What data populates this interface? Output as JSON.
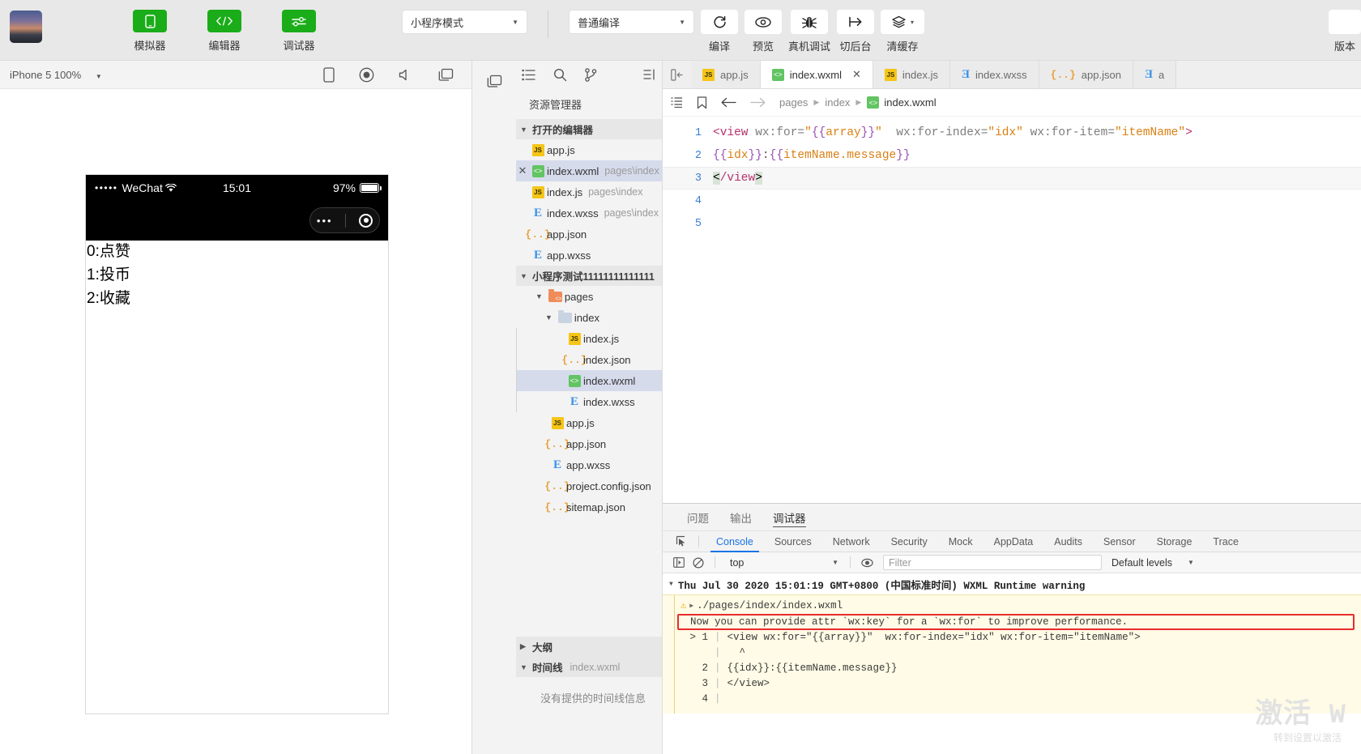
{
  "toolbar": {
    "avatar_name": "project-avatar",
    "buttons": [
      {
        "label": "模拟器",
        "icon": "phone-icon"
      },
      {
        "label": "编辑器",
        "icon": "code-icon"
      },
      {
        "label": "调试器",
        "icon": "sliders-icon"
      }
    ],
    "mode_select": "小程序模式",
    "compile_select": "普通编译",
    "actions": [
      {
        "label": "编译",
        "icon": "refresh-icon"
      },
      {
        "label": "预览",
        "icon": "eye-icon"
      },
      {
        "label": "真机调试",
        "icon": "bug-icon"
      },
      {
        "label": "切后台",
        "icon": "background-icon"
      },
      {
        "label": "清缓存",
        "icon": "layers-icon"
      }
    ],
    "version_label": "版本"
  },
  "simulator": {
    "device": "iPhone 5 100%",
    "toolbar_icons": [
      "rotate-device-icon",
      "record-icon",
      "volume-icon",
      "window-icon"
    ],
    "status_bar": {
      "signal_dots": "•••••",
      "carrier": "WeChat",
      "wifi": "wifi-icon",
      "time": "15:01",
      "battery_percent": "97%"
    },
    "capsule": {
      "more": "•••",
      "target": "target-icon"
    },
    "page_lines": [
      "0:点赞",
      "1:投币",
      "2:收藏"
    ]
  },
  "explorer": {
    "rail_icons": [
      "window-icon"
    ],
    "tool_icons": [
      "files-icon",
      "search-icon",
      "source-control-icon",
      "collapse-all-icon"
    ],
    "title": "资源管理器",
    "open_editors": {
      "label": "打开的编辑器",
      "items": [
        {
          "name": "app.js",
          "path": "",
          "icon": "js-icon",
          "selected": false,
          "closable": false
        },
        {
          "name": "index.wxml",
          "path": "pages\\index",
          "icon": "wxml-icon",
          "selected": true,
          "closable": true
        },
        {
          "name": "index.js",
          "path": "pages\\index",
          "icon": "js-icon",
          "selected": false,
          "closable": false
        },
        {
          "name": "index.wxss",
          "path": "pages\\index",
          "icon": "wxss-icon",
          "selected": false,
          "closable": false
        },
        {
          "name": "app.json",
          "path": "",
          "icon": "json-icon",
          "selected": false,
          "closable": false
        },
        {
          "name": "app.wxss",
          "path": "",
          "icon": "wxss-icon",
          "selected": false,
          "closable": false
        }
      ]
    },
    "project": {
      "label": "小程序测试11111111111111",
      "tree": [
        {
          "name": "pages",
          "icon": "folder-mini-icon",
          "depth": 1,
          "expanded": true,
          "selected": false
        },
        {
          "name": "index",
          "icon": "folder-icon",
          "depth": 2,
          "expanded": true,
          "selected": false
        },
        {
          "name": "index.js",
          "icon": "js-icon",
          "depth": 3,
          "selected": false
        },
        {
          "name": "index.json",
          "icon": "json-icon",
          "depth": 3,
          "selected": false
        },
        {
          "name": "index.wxml",
          "icon": "wxml-icon",
          "depth": 3,
          "selected": true
        },
        {
          "name": "index.wxss",
          "icon": "wxss-icon",
          "depth": 3,
          "selected": false
        },
        {
          "name": "app.js",
          "icon": "js-icon",
          "depth": 2,
          "selected": false
        },
        {
          "name": "app.json",
          "icon": "json-icon",
          "depth": 2,
          "selected": false
        },
        {
          "name": "app.wxss",
          "icon": "wxss-icon",
          "depth": 2,
          "selected": false
        },
        {
          "name": "project.config.json",
          "icon": "json-icon",
          "depth": 2,
          "selected": false
        },
        {
          "name": "sitemap.json",
          "icon": "json-icon",
          "depth": 2,
          "selected": false
        }
      ]
    },
    "outline": {
      "label": "大纲",
      "expanded": false
    },
    "timeline": {
      "label": "时间线",
      "file": "index.wxml",
      "expanded": true,
      "empty_text": "没有提供的时间线信息"
    }
  },
  "editor": {
    "tabs": [
      {
        "label": "app.js",
        "icon": "js-icon",
        "active": false,
        "closable": false
      },
      {
        "label": "index.wxml",
        "icon": "wxml-icon",
        "active": true,
        "closable": true
      },
      {
        "label": "index.js",
        "icon": "js-icon",
        "active": false,
        "closable": false
      },
      {
        "label": "index.wxss",
        "icon": "wxss-icon",
        "active": false,
        "closable": false
      },
      {
        "label": "app.json",
        "icon": "json-icon",
        "active": false,
        "closable": false
      },
      {
        "label": "a",
        "icon": "wxss-icon",
        "active": false,
        "closable": false
      }
    ],
    "breadcrumb": {
      "crumb1": "pages",
      "crumb2": "index",
      "crumb3": "index.wxml",
      "icon": "wxml-icon"
    },
    "lines": [
      {
        "num": "1",
        "text": "<view wx:for=\"{{array}}\"  wx:for-index=\"idx\" wx:for-item=\"itemName\">"
      },
      {
        "num": "2",
        "text": "{{idx}}:{{itemName.message}}"
      },
      {
        "num": "3",
        "text": "</view>"
      },
      {
        "num": "4",
        "text": ""
      },
      {
        "num": "5",
        "text": ""
      }
    ]
  },
  "debugger": {
    "panel_tabs": [
      {
        "label": "问题",
        "active": false
      },
      {
        "label": "输出",
        "active": false
      },
      {
        "label": "调试器",
        "active": true
      }
    ],
    "devtools_tabs": [
      {
        "label": "Console",
        "active": true
      },
      {
        "label": "Sources",
        "active": false
      },
      {
        "label": "Network",
        "active": false
      },
      {
        "label": "Security",
        "active": false
      },
      {
        "label": "Mock",
        "active": false
      },
      {
        "label": "AppData",
        "active": false
      },
      {
        "label": "Audits",
        "active": false
      },
      {
        "label": "Sensor",
        "active": false
      },
      {
        "label": "Storage",
        "active": false
      },
      {
        "label": "Trace",
        "active": false
      }
    ],
    "filter_bar": {
      "context": "top",
      "filter_placeholder": "Filter",
      "levels": "Default levels"
    },
    "console": {
      "header": "Thu Jul 30 2020 15:01:19 GMT+0800 (中国标准时间) WXML Runtime warning",
      "file": "./pages/index/index.wxml",
      "warning": "Now you can provide attr `wx:key` for a `wx:for` to improve performance.",
      "code_lines": [
        {
          "num": "> 1",
          "text": "<view wx:for=\"{{array}}\"  wx:for-index=\"idx\" wx:for-item=\"itemName\">"
        },
        {
          "num": "",
          "text": "  ^"
        },
        {
          "num": "  2",
          "text": "{{idx}}:{{itemName.message}}"
        },
        {
          "num": "  3",
          "text": "</view>"
        },
        {
          "num": "  4",
          "text": ""
        }
      ]
    }
  },
  "watermark": {
    "big": "激活 W",
    "sub": "转到设置以激活"
  }
}
